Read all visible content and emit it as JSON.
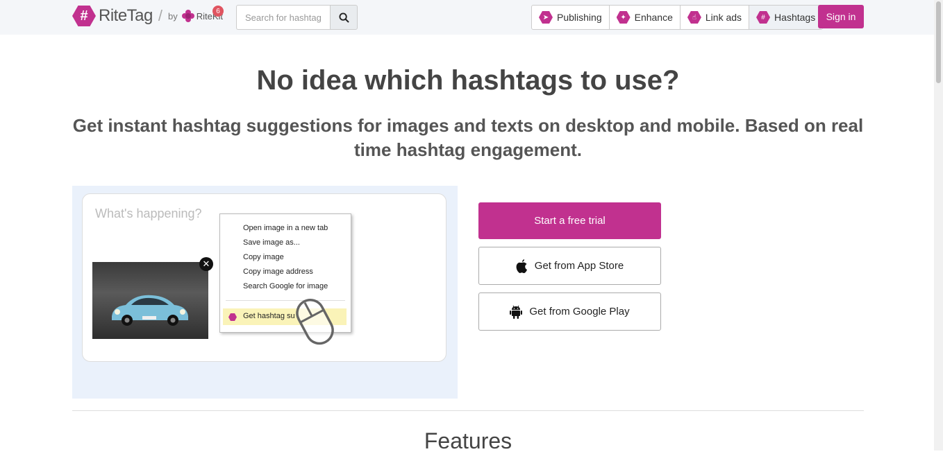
{
  "header": {
    "logo_mark": "#",
    "logo_text": "RiteTag",
    "by_text": "by",
    "ritekit_text": "RiteKit",
    "notification_count": "6",
    "search": {
      "placeholder": "Search for hashtags",
      "value": ""
    },
    "nav": [
      {
        "label": "Publishing",
        "icon": "send-icon"
      },
      {
        "label": "Enhance",
        "icon": "magic-wand-icon"
      },
      {
        "label": "Link ads",
        "icon": "pointer-icon"
      },
      {
        "label": "Hashtags",
        "icon": "hashtag-icon"
      }
    ],
    "signin_label": "Sign in"
  },
  "hero": {
    "title": "No idea which hashtags to use?",
    "subtitle": "Get instant hashtag suggestions for images and texts on desktop and mobile. Based on real time hashtag engagement."
  },
  "demo": {
    "placeholder": "What's happening?",
    "context_menu": [
      "Open image in a new tab",
      "Save image as...",
      "Copy image",
      "Copy image address",
      "Search Google for image"
    ],
    "highlighted_item": "Get hashtag su"
  },
  "cta": {
    "trial_label": "Start a free trial",
    "app_store_label": "Get from App Store",
    "google_play_label": "Get from Google Play"
  },
  "features_title": "Features",
  "colors": {
    "brand": "#c1318f",
    "demo_bg": "#eaf1fb",
    "highlight": "#faf3b8"
  }
}
